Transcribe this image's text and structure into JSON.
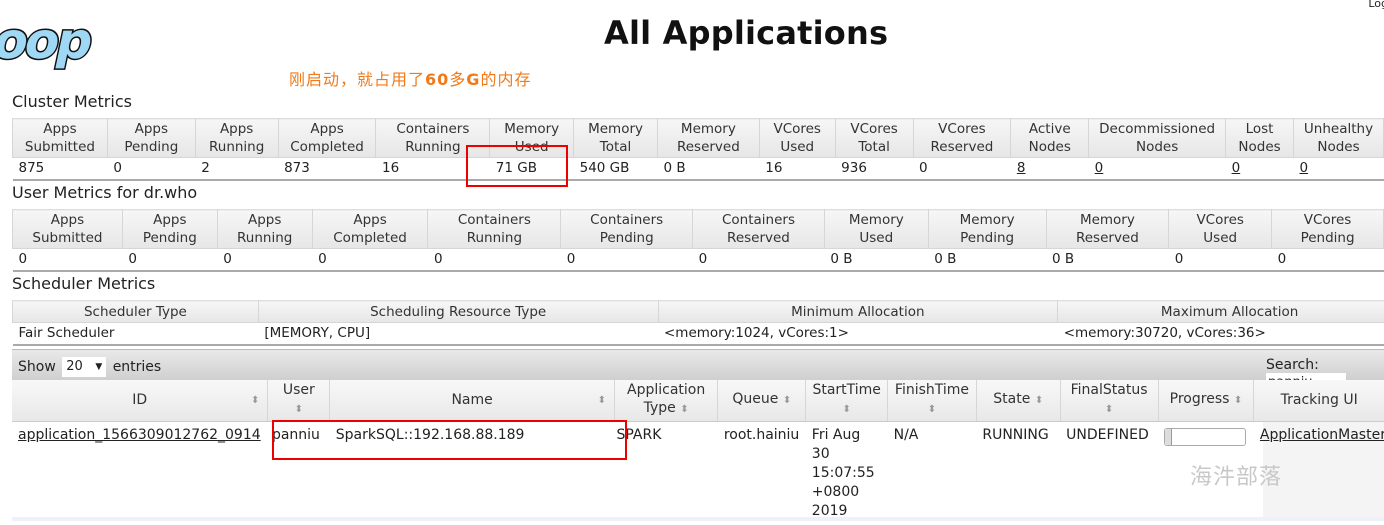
{
  "header": {
    "logo_text": "oop",
    "title": "All Applications",
    "logout_label": "Log",
    "annotation_text": "刚启动，就占用了60多G的内存",
    "annotation_color": "#f07a1a"
  },
  "cluster_metrics": {
    "title": "Cluster Metrics",
    "columns": [
      [
        "Apps",
        "Submitted"
      ],
      [
        "Apps",
        "Pending"
      ],
      [
        "Apps",
        "Running"
      ],
      [
        "Apps",
        "Completed"
      ],
      [
        "Containers",
        "Running"
      ],
      [
        "Memory",
        "Used"
      ],
      [
        "Memory",
        "Total"
      ],
      [
        "Memory",
        "Reserved"
      ],
      [
        "VCores",
        "Used"
      ],
      [
        "VCores",
        "Total"
      ],
      [
        "VCores",
        "Reserved"
      ],
      [
        "Active",
        "Nodes"
      ],
      [
        "Decommissioned",
        "Nodes"
      ],
      [
        "Lost",
        "Nodes"
      ],
      [
        "Unhealthy",
        "Nodes"
      ]
    ],
    "values": [
      "875",
      "0",
      "2",
      "873",
      "16",
      "71 GB",
      "540 GB",
      "0 B",
      "16",
      "936",
      "0",
      "8",
      "0",
      "0",
      "0"
    ],
    "highlighted_column": "Memory Used"
  },
  "user_metrics": {
    "title": "User Metrics for dr.who",
    "columns": [
      [
        "Apps",
        "Submitted"
      ],
      [
        "Apps",
        "Pending"
      ],
      [
        "Apps",
        "Running"
      ],
      [
        "Apps",
        "Completed"
      ],
      [
        "Containers",
        "Running"
      ],
      [
        "Containers",
        "Pending"
      ],
      [
        "Containers",
        "Reserved"
      ],
      [
        "Memory",
        "Used"
      ],
      [
        "Memory",
        "Pending"
      ],
      [
        "Memory",
        "Reserved"
      ],
      [
        "VCores",
        "Used"
      ],
      [
        "VCores",
        "Pending"
      ]
    ],
    "values": [
      "0",
      "0",
      "0",
      "0",
      "0",
      "0",
      "0",
      "0 B",
      "0 B",
      "0 B",
      "0",
      "0"
    ]
  },
  "scheduler_metrics": {
    "title": "Scheduler Metrics",
    "columns": [
      "Scheduler Type",
      "Scheduling Resource Type",
      "Minimum Allocation",
      "Maximum Allocation"
    ],
    "values": [
      "Fair Scheduler",
      "[MEMORY, CPU]",
      "<memory:1024, vCores:1>",
      "<memory:30720, vCores:36>"
    ]
  },
  "apps_table": {
    "show_label": "Show",
    "entries_label": "entries",
    "page_length": "20",
    "search_label": "Search:",
    "search_value": "panniu",
    "columns": [
      [
        "ID"
      ],
      [
        "User"
      ],
      [
        "Name"
      ],
      [
        "Application",
        "Type"
      ],
      [
        "Queue"
      ],
      [
        "StartTime"
      ],
      [
        "FinishTime"
      ],
      [
        "State"
      ],
      [
        "FinalStatus"
      ],
      [
        "Progress"
      ],
      [
        "Tracking UI"
      ]
    ],
    "rows": [
      {
        "id": "application_1566309012762_0914",
        "user": "panniu",
        "name": "SparkSQL::192.168.88.189",
        "type": "SPARK",
        "queue": "root.hainiu",
        "start_time": [
          "Fri Aug",
          "30",
          "15:07:55",
          "+0800",
          "2019"
        ],
        "finish_time": "N/A",
        "state": "RUNNING",
        "final_status": "UNDEFINED",
        "progress": 0.05,
        "tracking_ui": "ApplicationMaster"
      }
    ]
  },
  "watermark": "海汼部落"
}
